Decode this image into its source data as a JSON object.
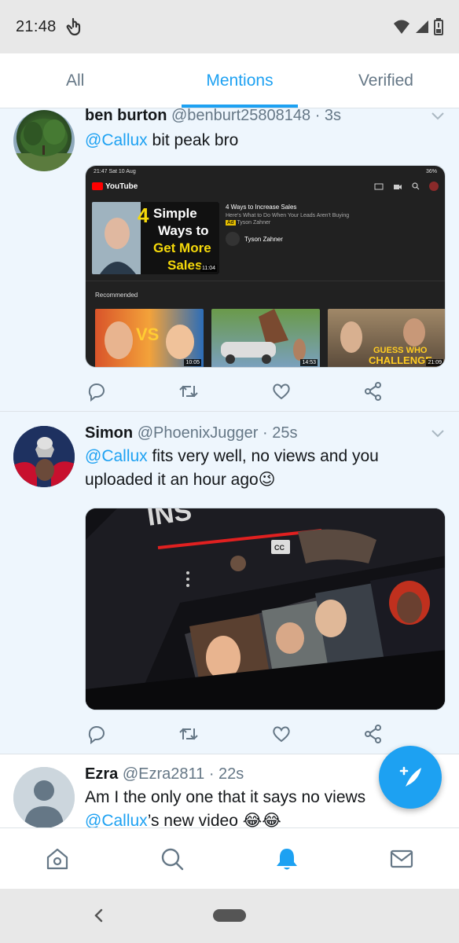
{
  "status_bar": {
    "time": "21:48"
  },
  "tabs": [
    {
      "label": "All"
    },
    {
      "label": "Mentions"
    },
    {
      "label": "Verified"
    }
  ],
  "tweets": [
    {
      "name": "ben burton",
      "handle": "@benburt25808148",
      "time": "· 3s",
      "mention": "@Callux",
      "text": " bit peak bro",
      "media": {
        "status_time": "21:47  Sat 10 Aug",
        "status_battery": "36%",
        "app_name": "YouTube",
        "video_title": "4 Ways to Increase Sales",
        "video_subtitle": "Here's What to Do When Your Leads Aren't Buying",
        "ad_badge": "Ad",
        "ad_channel": "Tyson Zahner",
        "channel_name": "Tyson Zahner",
        "thumb_text": [
          "4",
          "Simple",
          "Ways to",
          "Get More",
          "Sales"
        ],
        "thumb_duration": "11:04",
        "recommended_label": "Recommended",
        "rec_items": [
          {
            "duration": "10:05",
            "overlay": "VS"
          },
          {
            "duration": "14:53",
            "overlay": ""
          },
          {
            "duration": "21:09",
            "overlay": "GUESS WHO CHALLENGE"
          }
        ]
      }
    },
    {
      "name": "Simon",
      "handle": "@PhoenixJugger",
      "time": "· 25s",
      "mention": "@Callux",
      "text": " fits very well, no views and you uploaded it an hour ago😉",
      "media": {
        "overlay_text": "INS",
        "cc_label": "CC"
      }
    },
    {
      "name": "Ezra",
      "handle": "@Ezra2811",
      "time": "· 22s",
      "text_line1": "Am I the only one that it says no views ",
      "mention": "@Callux",
      "text_line2": "’s new video 😂😂"
    }
  ],
  "colors": {
    "accent": "#1da1f2",
    "text": "#14171a",
    "muted": "#657786"
  },
  "icons": [
    "reply-icon",
    "retweet-icon",
    "like-icon",
    "share-icon",
    "compose-icon",
    "home-icon",
    "search-icon",
    "notifications-icon",
    "messages-icon"
  ]
}
